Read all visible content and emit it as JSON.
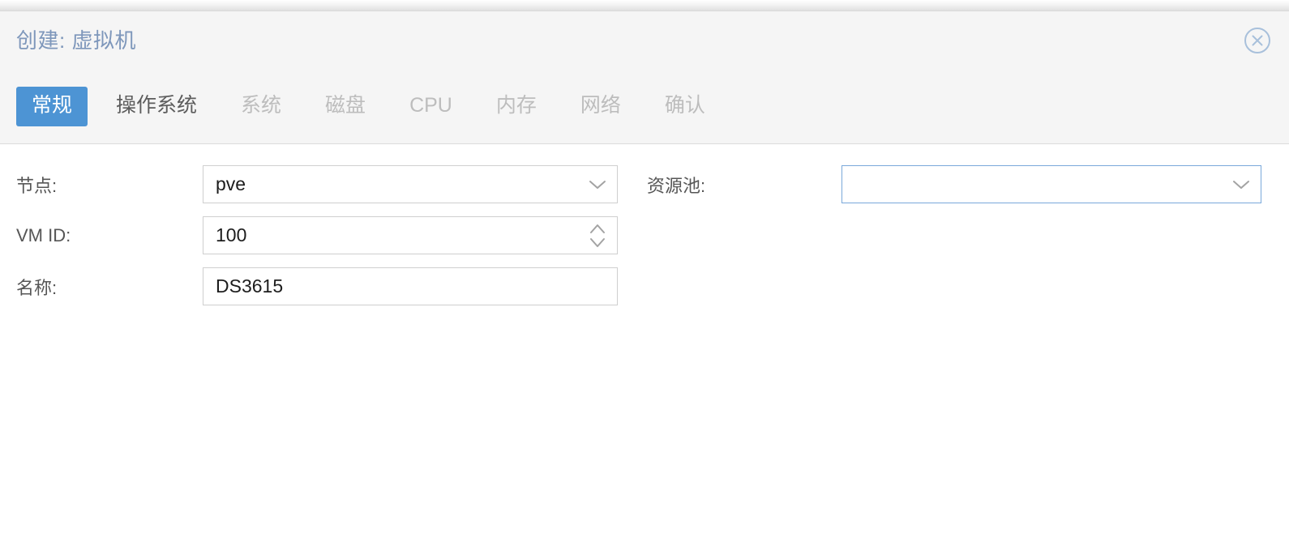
{
  "window": {
    "title": "创建: 虚拟机",
    "close_icon": "close-circle-icon"
  },
  "colors": {
    "accent": "#4d94d4",
    "title_text": "#7e97bb",
    "header_bg": "#f5f5f5",
    "body_bg": "#ffffff",
    "tab_disabled_text": "#bdbdbd",
    "tab_enabled_text": "#5c5c5c",
    "label_text": "#565656",
    "value_text": "#1d1d1d",
    "field_border": "#cfcfcf",
    "field_border_focused": "#7aa8da"
  },
  "tabs": [
    {
      "label": "常规",
      "state": "active"
    },
    {
      "label": "操作系统",
      "state": "enabled"
    },
    {
      "label": "系统",
      "state": "disabled"
    },
    {
      "label": "磁盘",
      "state": "disabled"
    },
    {
      "label": "CPU",
      "state": "disabled"
    },
    {
      "label": "内存",
      "state": "disabled"
    },
    {
      "label": "网络",
      "state": "disabled"
    },
    {
      "label": "确认",
      "state": "disabled"
    }
  ],
  "form": {
    "left": {
      "node": {
        "label": "节点:",
        "value": "pve",
        "control": "combobox",
        "icon": "chevron-down-icon"
      },
      "vmid": {
        "label": "VM ID:",
        "value": "100",
        "control": "spinner",
        "icon": "spinner-arrows-icon"
      },
      "name": {
        "label": "名称:",
        "value": "DS3615",
        "control": "textfield",
        "icon": ""
      }
    },
    "right": {
      "pool": {
        "label": "资源池:",
        "value": "",
        "placeholder": "",
        "control": "combobox",
        "icon": "chevron-down-icon",
        "focused": true
      }
    }
  }
}
